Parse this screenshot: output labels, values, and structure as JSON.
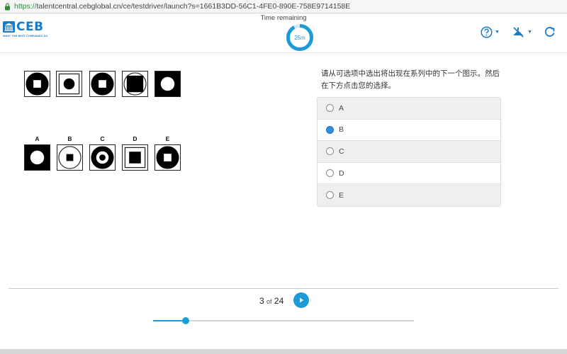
{
  "browser": {
    "url_protocol": "https://",
    "url_rest": "talentcentral.cebglobal.cn/ce/testdriver/launch?s=1661B3DD-56C1-4FE0-890E-758E9714158E"
  },
  "header": {
    "logo_text": "CEB",
    "logo_tagline": "WHAT THE BEST COMPANIES DO",
    "time_label": "Time remaining",
    "timer_value": "25m",
    "timer_fraction": 0.92,
    "icons": [
      "help-icon",
      "accessibility-icon",
      "exit-icon"
    ]
  },
  "question": {
    "instruction": "请从可选项中选出将出现在系列中的下一个图示。然后在下方点击您的选择。",
    "series_tiles": [
      {
        "outer": "circle-black",
        "inner": "square-white"
      },
      {
        "outer": "square-outline",
        "inner": "circle-black"
      },
      {
        "outer": "circle-black",
        "inner": "square-white"
      },
      {
        "outer": "circle-outline",
        "inner": "square-black"
      },
      {
        "outer": "square-black",
        "inner": "circle-white"
      }
    ],
    "option_tiles": [
      {
        "letter": "A",
        "outer": "square-black",
        "inner": "circle-white"
      },
      {
        "letter": "B",
        "outer": "circle-outline",
        "inner": "square-black"
      },
      {
        "letter": "C",
        "outer": "circle-black",
        "inner": "circle-white-ring"
      },
      {
        "letter": "D",
        "outer": "square-outline",
        "inner": "square-black"
      },
      {
        "letter": "E",
        "outer": "circle-black",
        "inner": "square-white"
      }
    ],
    "answer_options": [
      {
        "label": "A",
        "checked": false
      },
      {
        "label": "B",
        "checked": true
      },
      {
        "label": "C",
        "checked": false
      },
      {
        "label": "D",
        "checked": false
      },
      {
        "label": "E",
        "checked": false
      }
    ],
    "selected": "B"
  },
  "footer": {
    "current": "3",
    "of_label": "of",
    "total": "24",
    "progress_fraction": 0.125
  },
  "colors": {
    "accent": "#1d9bd8",
    "brand": "#1a7bc4",
    "radio_checked": "#2e8fe0"
  }
}
